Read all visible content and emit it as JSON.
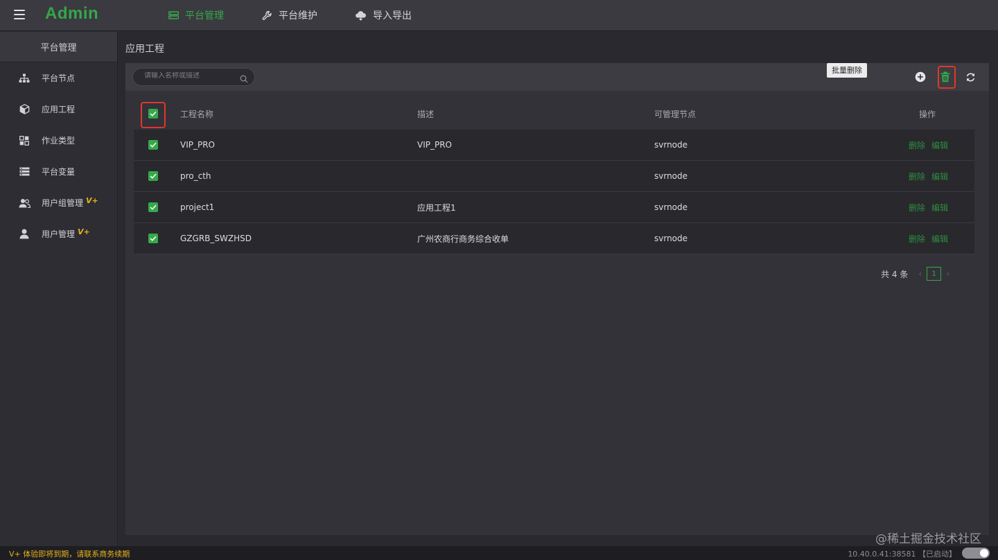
{
  "app": {
    "logo": "Admin",
    "nav": [
      {
        "label": "平台管理",
        "icon": "server-icon",
        "active": true
      },
      {
        "label": "平台维护",
        "icon": "wrench-icon",
        "active": false
      },
      {
        "label": "导入导出",
        "icon": "cloud-icon",
        "active": false
      }
    ],
    "accent_color": "#36a94b",
    "highlight_color": "#e0382c"
  },
  "sidebar": {
    "title": "平台管理",
    "items": [
      {
        "label": "平台节点",
        "icon": "sitemap-icon"
      },
      {
        "label": "应用工程",
        "icon": "cube-icon"
      },
      {
        "label": "作业类型",
        "icon": "grid-icon"
      },
      {
        "label": "平台变量",
        "icon": "list-icon"
      },
      {
        "label": "用户组管理",
        "icon": "users-icon",
        "badge": "V+"
      },
      {
        "label": "用户管理",
        "icon": "user-icon",
        "badge": "V+"
      }
    ]
  },
  "main": {
    "page_title": "应用工程",
    "search": {
      "placeholder": "请输入名称或描述",
      "value": ""
    },
    "toolbar": {
      "add_icon": "plus-circle-icon",
      "delete_icon": "trash-icon",
      "refresh_icon": "refresh-icon",
      "tooltip": "批量删除"
    },
    "table": {
      "headers": {
        "name": "工程名称",
        "desc": "描述",
        "node": "可管理节点",
        "op": "操作"
      },
      "rows": [
        {
          "name": "VIP_PRO",
          "desc": "VIP_PRO",
          "node": "svrnode",
          "checked": true
        },
        {
          "name": "pro_cth",
          "desc": "",
          "node": "svrnode",
          "checked": true
        },
        {
          "name": "project1",
          "desc": "应用工程1",
          "node": "svrnode",
          "checked": true
        },
        {
          "name": "GZGRB_SWZHSD",
          "desc": "广州农商行商务综合收单",
          "node": "svrnode",
          "checked": true
        }
      ],
      "delete_label": "删除",
      "edit_label": "编辑"
    },
    "pager": {
      "total_text": "共 4 条",
      "prev": "‹",
      "next": "›",
      "current_page": "1"
    }
  },
  "footer": {
    "expire_notice": "V+ 体验即将到期，请联系商务续期",
    "status": "10.40.0.41:38581 【已启动】"
  },
  "watermark": "@稀土掘金技术社区"
}
